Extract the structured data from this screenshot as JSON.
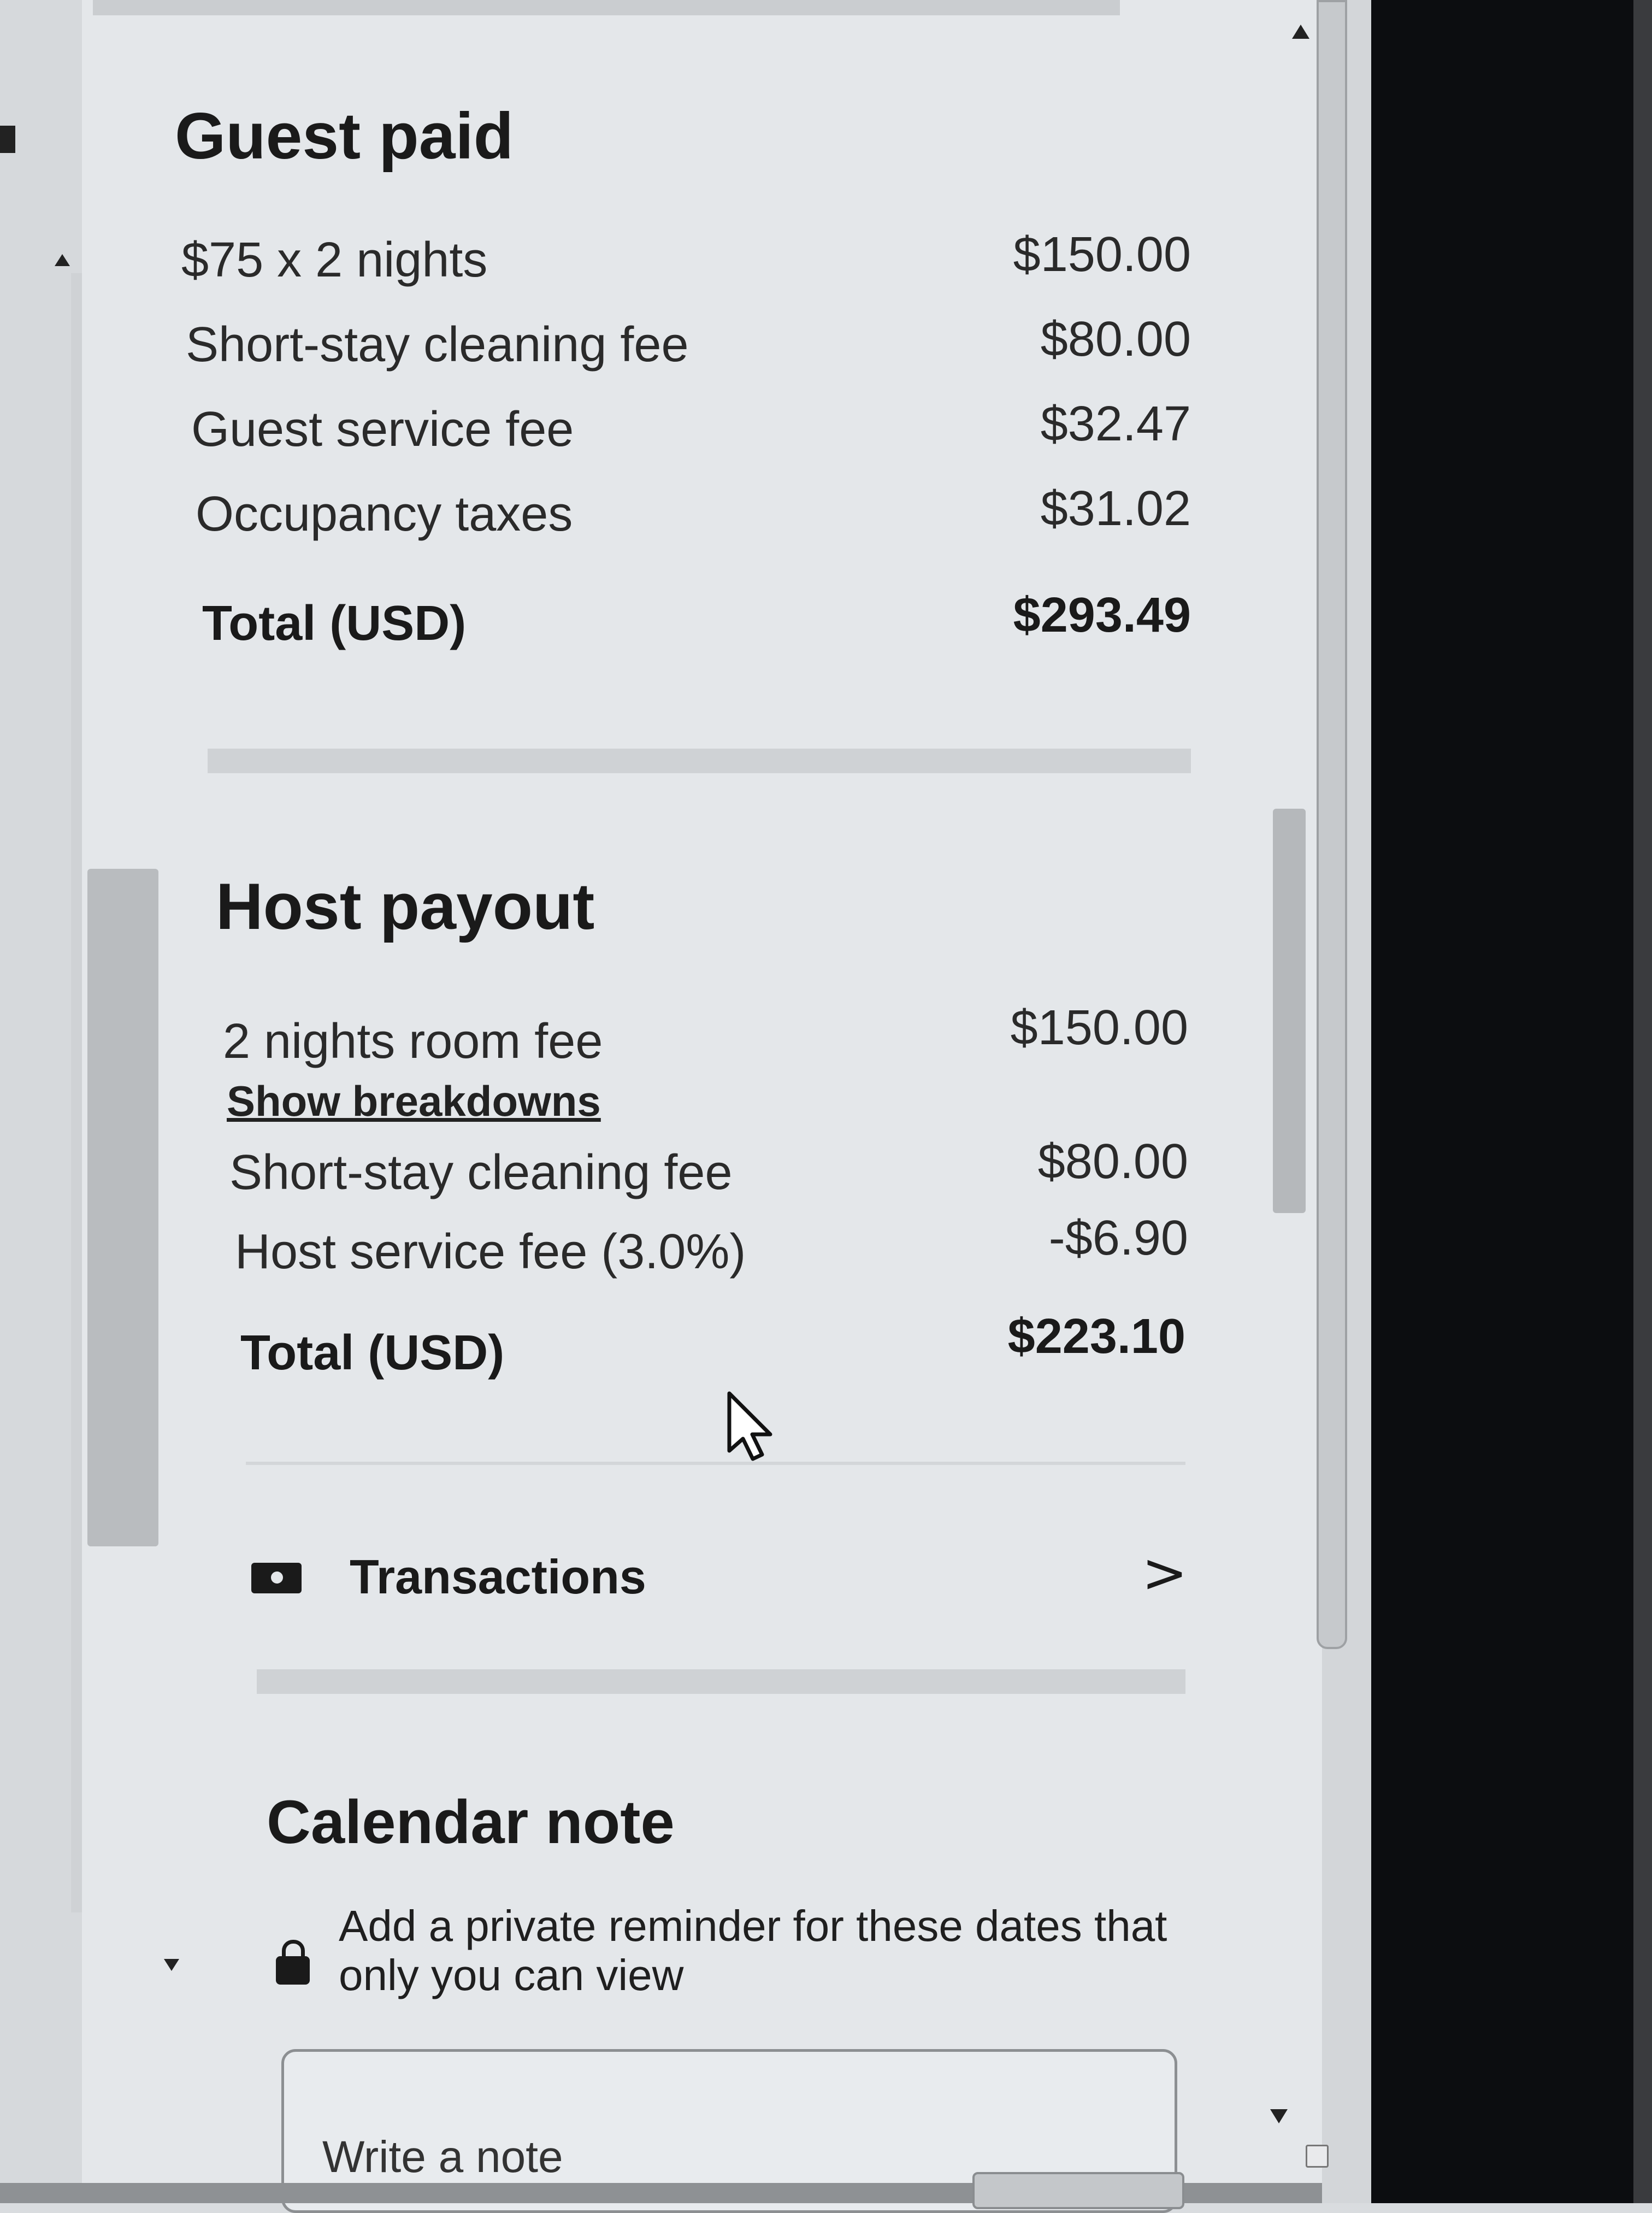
{
  "guest_paid": {
    "title": "Guest paid",
    "rows": [
      {
        "label": "$75 x 2 nights",
        "amount": "$150.00"
      },
      {
        "label": "Short-stay cleaning fee",
        "amount": "$80.00"
      },
      {
        "label": "Guest service fee",
        "amount": "$32.47"
      },
      {
        "label": "Occupancy taxes",
        "amount": "$31.02"
      }
    ],
    "total_label": "Total (USD)",
    "total_amount": "$293.49"
  },
  "host_payout": {
    "title": "Host payout",
    "rows": [
      {
        "label": "2 nights room fee",
        "amount": "$150.00"
      },
      {
        "label": "Short-stay cleaning fee",
        "amount": "$80.00"
      },
      {
        "label": "Host service fee (3.0%)",
        "amount": "-$6.90"
      }
    ],
    "breakdown_link": "Show breakdowns",
    "total_label": "Total (USD)",
    "total_amount": "$223.10"
  },
  "transactions": {
    "label": "Transactions",
    "icon": "money-icon",
    "chevron": ">"
  },
  "calendar_note": {
    "title": "Calendar note",
    "description": "Add a private reminder for these dates that only you can view",
    "placeholder": "Write a note",
    "icon": "lock-icon"
  },
  "colors": {
    "panel_background": "#e4e7ea",
    "text_primary": "#1a1a1a",
    "bezel": "#0c0d10"
  }
}
